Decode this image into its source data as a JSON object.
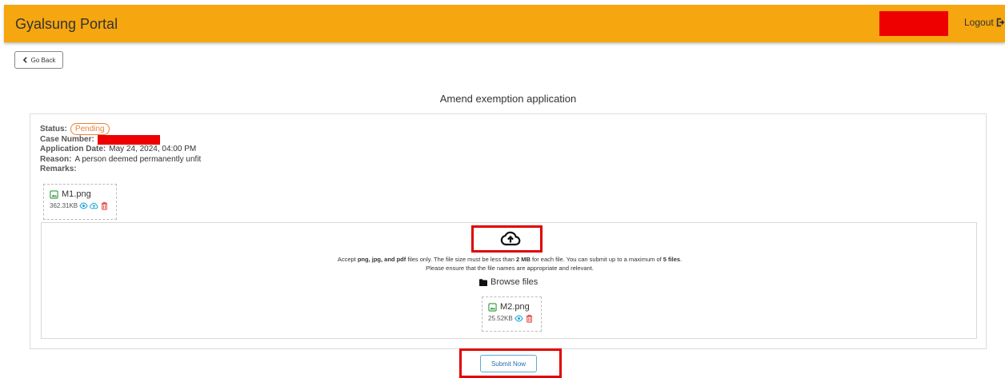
{
  "header": {
    "brand": "Gyalsung Portal",
    "logout_label": "Logout",
    "accent_color": "#f6a60e"
  },
  "nav": {
    "go_back_label": "Go Back"
  },
  "page": {
    "title": "Amend exemption application"
  },
  "application": {
    "status_label": "Status:",
    "status_value": "Pending",
    "case_number_label": "Case Number:",
    "application_date_label": "Application Date:",
    "application_date_value": "May 24, 2024, 04:00 PM",
    "reason_label": "Reason:",
    "reason_value": "A person deemed permanently unfit",
    "remarks_label": "Remarks:"
  },
  "existing_file": {
    "name": "M1.png",
    "size": "362.31KB"
  },
  "upload": {
    "accept_prefix": "Accept ",
    "accept_types": "png, jpg, and pdf",
    "accept_middle": " files only. The file size must be less than ",
    "max_size": "2 MB",
    "accept_suffix": " for each file. You can submit up to a maximum of ",
    "max_files": "5 files",
    "accept_end": ".",
    "names_note": "Please ensure that the file names are appropriate and relevant.",
    "browse_label": "Browse files"
  },
  "new_file": {
    "name": "M2.png",
    "size": "25.52KB"
  },
  "actions": {
    "submit_label": "Submit Now"
  },
  "icons": {
    "logout": "logout-icon",
    "back": "chevron-left-icon",
    "image_file": "image-file-icon",
    "view": "eye-icon",
    "reupload": "cloud-upload-icon",
    "delete": "trash-icon",
    "upload": "cloud-upload-icon",
    "folder": "folder-icon"
  },
  "colors": {
    "pending": "#e8833a",
    "view_icon": "#1aa6d6",
    "delete_icon": "#e04848",
    "file_icon": "#2e9a3a",
    "highlight": "#e00000",
    "redaction": "#ee0000"
  }
}
